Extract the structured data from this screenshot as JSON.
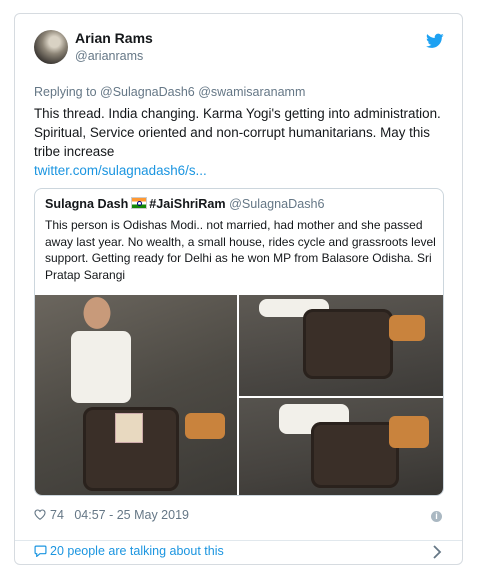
{
  "author": {
    "name": "Arian Rams",
    "handle": "@arianrams"
  },
  "reply": {
    "prefix": "Replying to",
    "mentions": "@SulagnaDash6 @swamisaranamm"
  },
  "tweet": {
    "text": "This thread. India changing. Karma Yogi's getting into administration. Spiritual, Service oriented and non-corrupt humanitarians.  May this tribe increase",
    "link": "twitter.com/sulagnadash6/s..."
  },
  "quoted": {
    "name": "Sulagna Dash",
    "hashtag": "#JaiShriRam",
    "handle": "@SulagnaDash6",
    "text": "This person is Odishas Modi.. not married, had mother and she passed away last year. No wealth, a small house, rides cycle and grassroots level support. Getting ready for Delhi as he won MP from Balasore Odisha. Sri  Pratap Sarangi"
  },
  "meta": {
    "likes": "74",
    "timestamp": "04:57 - 25 May 2019"
  },
  "footer": {
    "talking": "20 people are talking about this"
  },
  "colors": {
    "link": "#1b95e0",
    "twitter_blue": "#1da1f2",
    "muted": "#657786"
  },
  "icons": [
    "twitter-bird-icon",
    "heart-icon",
    "info-icon",
    "speech-bubble-icon",
    "chevron-right-icon",
    "india-flag-icon"
  ]
}
